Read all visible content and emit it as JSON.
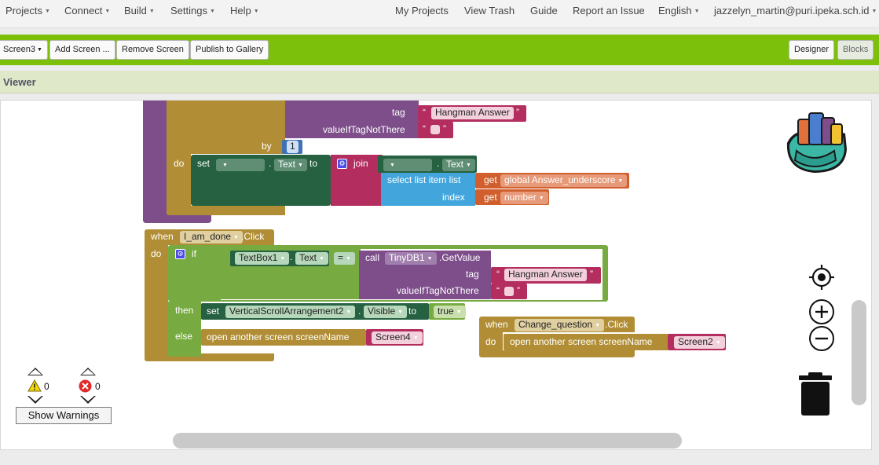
{
  "topnav": {
    "menus": [
      "Projects",
      "Connect",
      "Build",
      "Settings",
      "Help"
    ],
    "links": [
      "My Projects",
      "View Trash",
      "Guide",
      "Report an Issue"
    ],
    "language": "English",
    "user": "jazzelyn_martin@puri.ipeka.sch.id"
  },
  "toolbar": {
    "screen_select": "Screen3",
    "add_screen": "Add Screen ...",
    "remove_screen": "Remove Screen",
    "publish": "Publish to Gallery",
    "designer": "Designer",
    "blocks": "Blocks"
  },
  "viewer": {
    "title": "Viewer"
  },
  "blocks": {
    "top": {
      "tag_label": "tag",
      "tag_value": "Hangman Answer",
      "vitnt_label": "valueIfTagNotThere",
      "by_label": "by",
      "by_value": "1",
      "do_label": "do",
      "set_label": "set",
      "text_prop": "Text",
      "to_label": "to",
      "join_label": "join",
      "text_prop2": "Text",
      "select_label": "select list item  list",
      "get_label": "get",
      "get_var1": "global Answer_underscore",
      "index_label": "index",
      "get_label2": "get",
      "get_var2": "number"
    },
    "i_am_done": {
      "when_label": "when",
      "component": "I_am_done",
      "event": ".Click",
      "do_label": "do",
      "if_label": "if",
      "textbox": "TextBox1",
      "dot": ".",
      "text_prop": "Text",
      "eq_op": "=",
      "call_label": "call",
      "tinydb": "TinyDB1",
      "getvalue": ".GetValue",
      "tag_label": "tag",
      "tag_value": "Hangman Answer",
      "vitnt_label": "valueIfTagNotThere",
      "then_label": "then",
      "set_label": "set",
      "arrangement": "VerticalScrollArrangement2",
      "visible_prop": "Visible",
      "to_label": "to",
      "true_value": "true",
      "else_label": "else",
      "open_screen_label": "open another screen  screenName",
      "screen_value": "Screen4"
    },
    "change_question": {
      "when_label": "when",
      "component": "Change_question",
      "event": ".Click",
      "do_label": "do",
      "open_screen_label": "open another screen  screenName",
      "screen_value": "Screen2"
    }
  },
  "warnings": {
    "warning_count": "0",
    "error_count": "0",
    "show_warnings": "Show Warnings"
  },
  "colors": {
    "toolbar_green": "#7cc00b",
    "control_gold": "#b18e35",
    "logic_green": "#77ab41",
    "component_dark_green": "#266141",
    "text_magenta": "#b32d5e",
    "list_blue": "#42a6dc",
    "variable_orange": "#d05f2d",
    "component_purple": "#7d4e8a",
    "math_blue": "#3f71b5"
  }
}
